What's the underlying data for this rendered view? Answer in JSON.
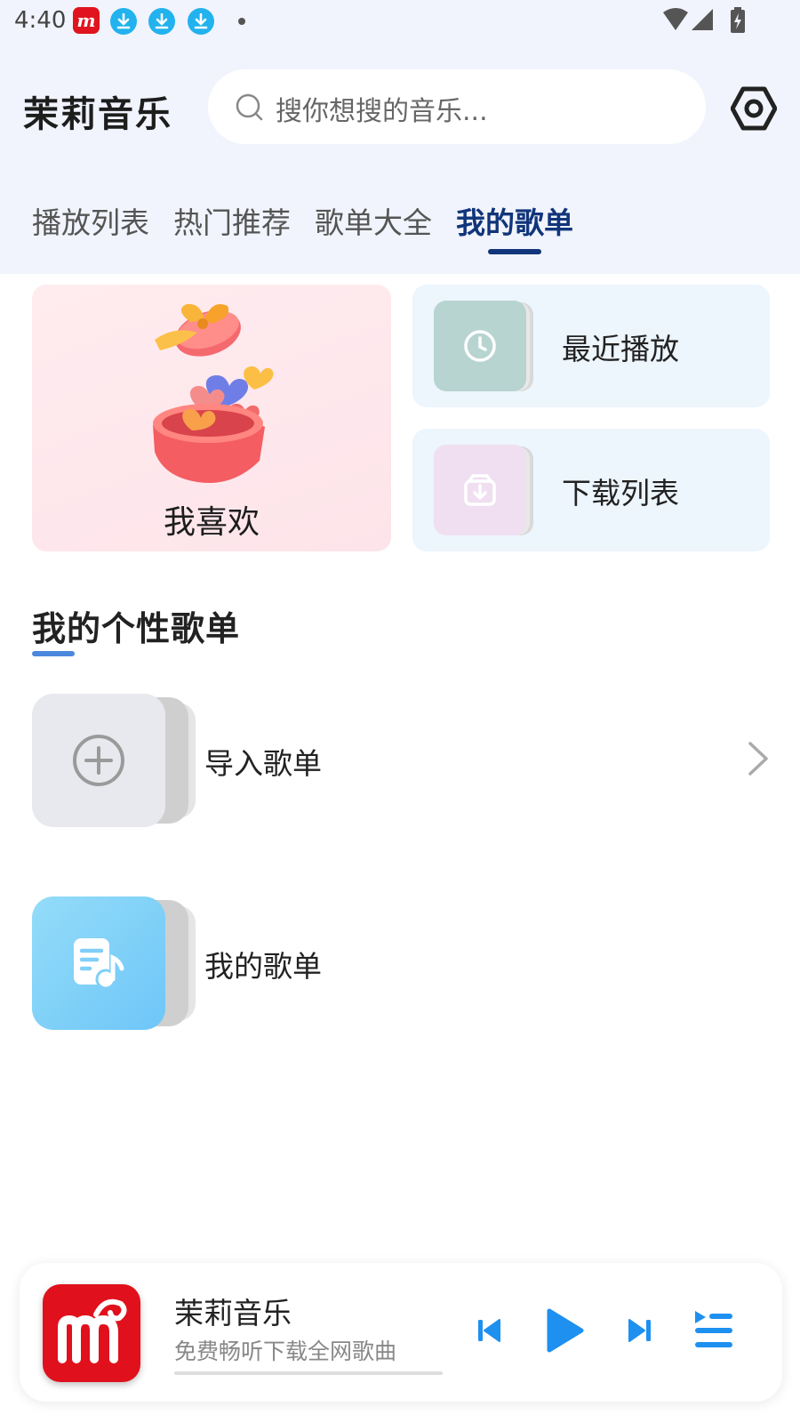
{
  "status_bar": {
    "time": "4:40",
    "icons": [
      "app-notification-icon",
      "download-icon",
      "download-icon",
      "download-icon",
      "dot-icon",
      "wifi-icon",
      "cell-signal-icon",
      "battery-charging-icon"
    ]
  },
  "header": {
    "app_title": "茉莉音乐",
    "search_placeholder": "搜你想搜的音乐...",
    "settings_icon": "settings-hexagon-icon"
  },
  "tabs": [
    {
      "label": "播放列表",
      "active": false
    },
    {
      "label": "热门推荐",
      "active": false
    },
    {
      "label": "歌单大全",
      "active": false
    },
    {
      "label": "我的歌单",
      "active": true
    }
  ],
  "cards": {
    "favorite": {
      "label": "我喜欢"
    },
    "recent": {
      "label": "最近播放",
      "icon": "clock-icon"
    },
    "downloads": {
      "label": "下载列表",
      "icon": "download-box-icon"
    }
  },
  "section": {
    "title": "我的个性歌单",
    "items": [
      {
        "label": "导入歌单",
        "icon": "add-circle-icon"
      },
      {
        "label": "我的歌单",
        "icon": "music-note-doc-icon"
      }
    ]
  },
  "player": {
    "title": "茉莉音乐",
    "subtitle": "免费畅听下载全网歌曲",
    "progress": 0
  },
  "colors": {
    "accent_dark": "#11357a",
    "accent_blue": "#1e90f0",
    "brand_red": "#e0111c"
  }
}
